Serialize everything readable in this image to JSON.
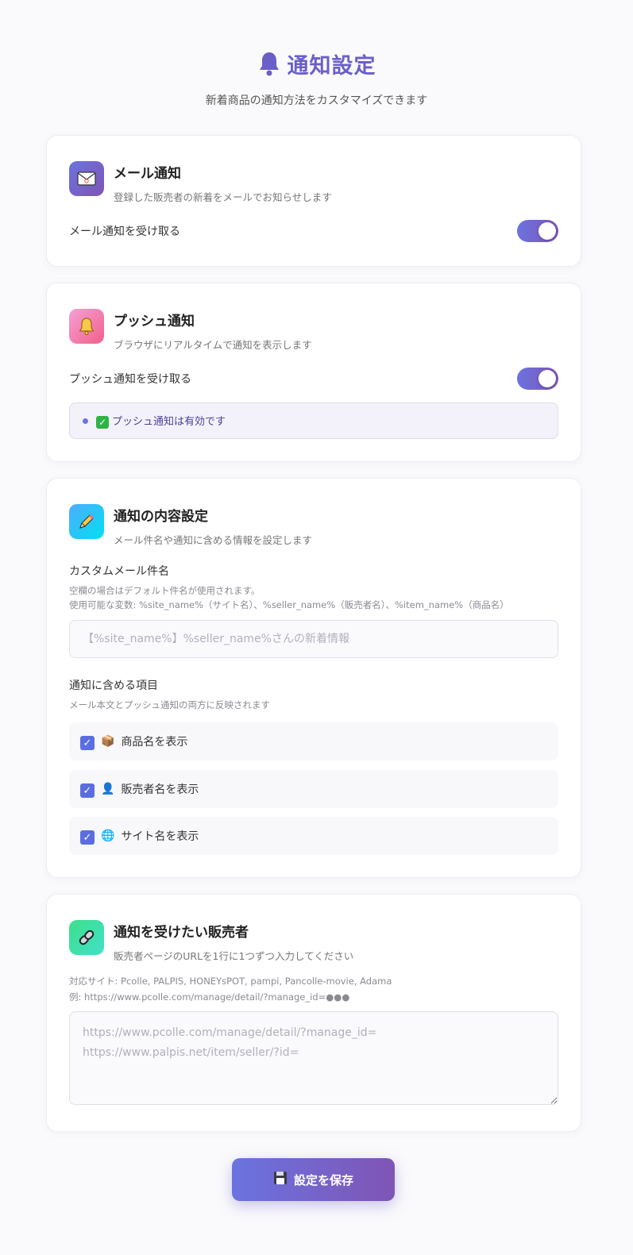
{
  "header": {
    "icon": "bell-icon",
    "title": "通知設定",
    "subtitle": "新着商品の通知方法をカスタマイズできます"
  },
  "email_card": {
    "icon": "envelope-icon",
    "title": "メール通知",
    "desc": "登録した販売者の新着をメールでお知らせします",
    "toggle_label": "メール通知を受け取る",
    "enabled": true
  },
  "push_card": {
    "icon": "bell-icon",
    "title": "プッシュ通知",
    "desc": "ブラウザにリアルタイムで通知を表示します",
    "toggle_label": "プッシュ通知を受け取る",
    "enabled": true,
    "status_text": "プッシュ通知は有効です"
  },
  "content_card": {
    "icon": "pencil-icon",
    "title": "通知の内容設定",
    "desc": "メール件名や通知に含める情報を設定します",
    "subject_label": "カスタムメール件名",
    "subject_help_1": "空欄の場合はデフォルト件名が使用されます。",
    "subject_help_2": "使用可能な変数: %site_name%（サイト名）、%seller_name%（販売者名）、%item_name%（商品名）",
    "subject_placeholder": "【%site_name%】%seller_name%さんの新着情報",
    "include_label": "通知に含める項目",
    "include_help": "メール本文とプッシュ通知の両方に反映されます",
    "items": [
      {
        "icon": "package-icon",
        "emoji": "📦",
        "label": "商品名を表示",
        "checked": true
      },
      {
        "icon": "person-icon",
        "emoji": "👤",
        "label": "販売者名を表示",
        "checked": true
      },
      {
        "icon": "globe-icon",
        "emoji": "🌐",
        "label": "サイト名を表示",
        "checked": true
      }
    ]
  },
  "seller_card": {
    "icon": "link-icon",
    "title": "通知を受けたい販売者",
    "desc": "販売者ページのURLを1行に1つずつ入力してください",
    "help_1": "対応サイト: Pcolle, PALPIS, HONEYsPOT, pampi, Pancolle-movie, Adama",
    "help_2": "例: https://www.pcolle.com/manage/detail/?manage_id=●●●",
    "placeholder": "https://www.pcolle.com/manage/detail/?manage_id=\nhttps://www.palpis.net/item/seller/?id="
  },
  "save_button": {
    "icon": "floppy-disk-icon",
    "label": "設定を保存"
  },
  "colors": {
    "accent": "#6b5fc7",
    "gradient_start": "#6b73e0",
    "gradient_end": "#7f55b5"
  }
}
